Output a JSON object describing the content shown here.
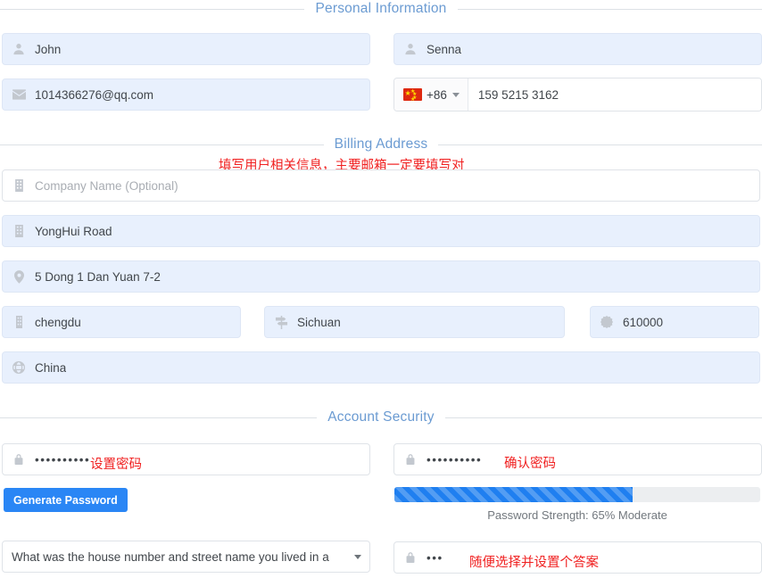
{
  "sections": {
    "personal": {
      "title": "Personal Information"
    },
    "billing": {
      "title": "Billing Address"
    },
    "security": {
      "title": "Account Security"
    }
  },
  "personal": {
    "first_name": {
      "value": "John",
      "icon": "user-icon"
    },
    "last_name": {
      "value": "Senna",
      "icon": "user-icon"
    },
    "email": {
      "value": "1014366276@qq.com",
      "icon": "envelope-icon"
    },
    "phone": {
      "country_code": "+86",
      "flag": "china-flag-icon",
      "value": "159 5215 3162"
    }
  },
  "billing": {
    "company": {
      "placeholder": "Company Name (Optional)",
      "value": "",
      "icon": "building-icon"
    },
    "address1": {
      "value": "YongHui Road",
      "icon": "building-icon"
    },
    "address2": {
      "value": "5 Dong 1 Dan Yuan 7-2",
      "icon": "map-marker-icon"
    },
    "city": {
      "value": "chengdu",
      "icon": "building-icon"
    },
    "state": {
      "value": "Sichuan",
      "icon": "map-signs-icon"
    },
    "zip": {
      "value": "610000",
      "icon": "certificate-icon"
    },
    "country": {
      "value": "China",
      "icon": "globe-icon"
    }
  },
  "security": {
    "password": {
      "value": "••••••••••",
      "icon": "lock-icon"
    },
    "confirm_password": {
      "value": "••••••••••",
      "icon": "lock-icon"
    },
    "generate_button": "Generate Password",
    "strength": {
      "percent": 65,
      "label": "Password Strength: 65% Moderate",
      "fill_width": "65%"
    },
    "question": {
      "value": "What was the house number and street name you lived in a"
    },
    "answer": {
      "value": "•••",
      "icon": "lock-icon"
    }
  },
  "annotations": {
    "billing_note": "填写用户相关信息，主要邮箱一定要填写对",
    "set_password": "设置密码",
    "confirm_password": "确认密码",
    "answer_note": "随便选择并设置个答案"
  },
  "colors": {
    "heading": "#6b9bd2",
    "annotation": "#f02020",
    "primary": "#2a86f5",
    "autofill_bg": "#e8f0fd"
  }
}
